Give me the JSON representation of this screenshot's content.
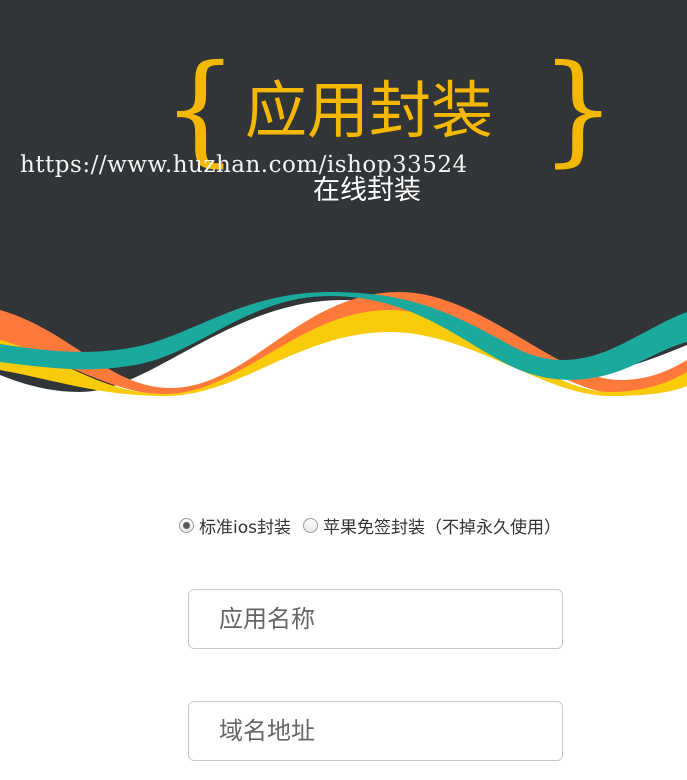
{
  "header": {
    "title": "应用封装",
    "brace_left": "{",
    "brace_right": "}",
    "subtitle": "在线封装",
    "watermark": "https://www.huzhan.com/ishop33524",
    "colors": {
      "background": "#323538",
      "title": "#f5b800",
      "wave_orange": "#ff7a3a",
      "wave_yellow": "#f9cb0b",
      "wave_teal": "#1aa99d"
    }
  },
  "package_type": {
    "options": [
      {
        "label": "标准ios封装",
        "checked": true
      },
      {
        "label": "苹果免签封装（不掉永久使用）",
        "checked": false
      }
    ]
  },
  "form": {
    "app_name": {
      "placeholder": "应用名称",
      "value": ""
    },
    "domain": {
      "placeholder": "域名地址",
      "value": ""
    }
  }
}
